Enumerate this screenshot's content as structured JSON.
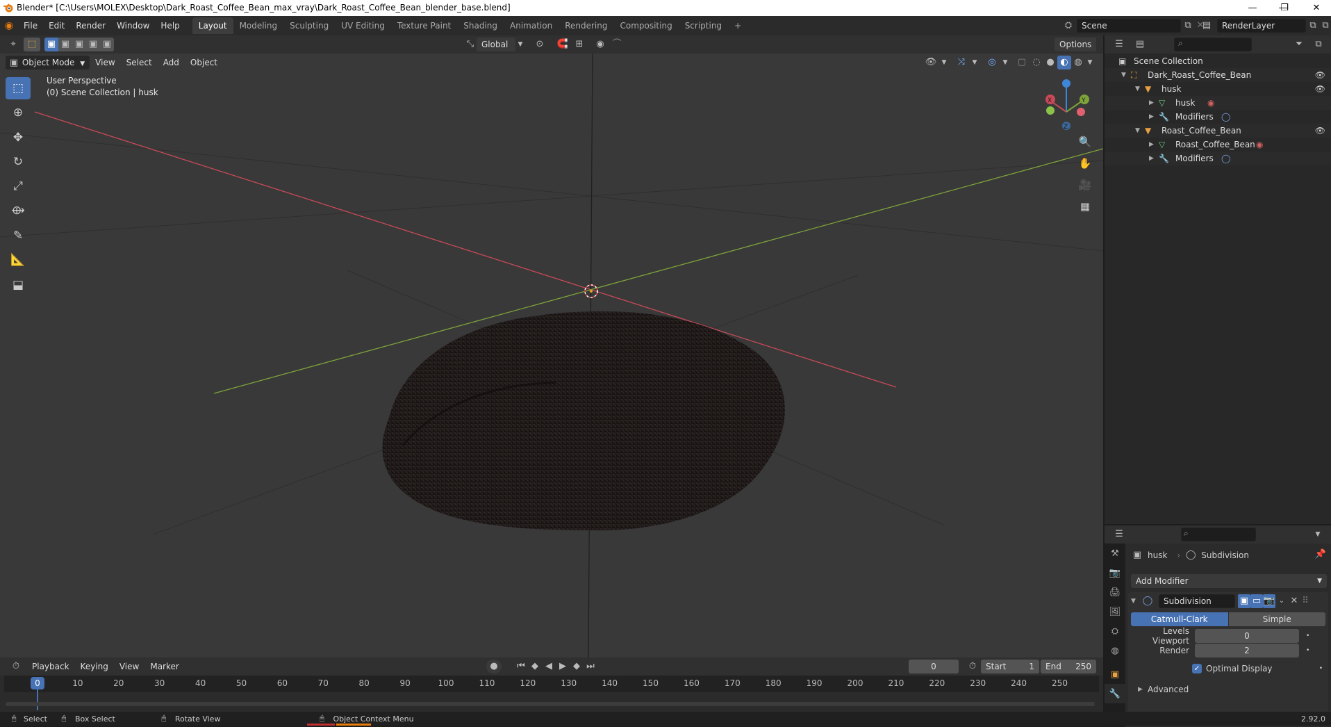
{
  "window": {
    "title": "Blender* [C:\\Users\\MOLEX\\Desktop\\Dark_Roast_Coffee_Bean_max_vray\\Dark_Roast_Coffee_Bean_blender_base.blend]",
    "controls": [
      "—",
      "❐",
      "✕"
    ]
  },
  "menu": [
    "File",
    "Edit",
    "Render",
    "Window",
    "Help"
  ],
  "workspaces": [
    "Layout",
    "Modeling",
    "Sculpting",
    "UV Editing",
    "Texture Paint",
    "Shading",
    "Animation",
    "Rendering",
    "Compositing",
    "Scripting"
  ],
  "workspace_add": "+",
  "scene": {
    "name": "Scene",
    "render_layer": "RenderLayer"
  },
  "viewport": {
    "transform_orientation": "Global",
    "options_label": "Options",
    "mode": "Object Mode",
    "header_menus": [
      "View",
      "Select",
      "Add",
      "Object"
    ],
    "overlay_title": "User Perspective",
    "overlay_sub": "(0) Scene Collection | husk",
    "gizmo_axes": [
      "X",
      "Y",
      "Z"
    ]
  },
  "outliner": {
    "search_placeholder": "",
    "rows": [
      {
        "label": "Scene Collection",
        "icon": "collection-icon",
        "visible": false
      },
      {
        "label": "Dark_Roast_Coffee_Bean",
        "icon": "scene-object-icon",
        "visible": true
      },
      {
        "label": "husk",
        "icon": "object-icon",
        "visible": true
      },
      {
        "label": "husk",
        "icon": "mesh-icon",
        "visible": false
      },
      {
        "label": "Modifiers",
        "icon": "wrench-icon",
        "visible": false
      },
      {
        "label": "Roast_Coffee_Bean",
        "icon": "object-icon",
        "visible": true
      },
      {
        "label": "Roast_Coffee_Bean",
        "icon": "mesh-icon",
        "visible": false
      },
      {
        "label": "Modifiers",
        "icon": "wrench-icon",
        "visible": false
      }
    ]
  },
  "properties": {
    "breadcrumb_object": "husk",
    "breadcrumb_modifier": "Subdivision",
    "add_modifier": "Add Modifier",
    "modifier_name": "Subdivision",
    "mode_catmull": "Catmull-Clark",
    "mode_simple": "Simple",
    "levels_viewport_label": "Levels Viewport",
    "levels_viewport_value": "0",
    "render_label": "Render",
    "render_value": "2",
    "optimal_display": "Optimal Display",
    "advanced": "Advanced"
  },
  "timeline": {
    "menus": [
      "Playback",
      "Keying",
      "View",
      "Marker"
    ],
    "current_frame": "0",
    "start_label": "Start",
    "start_value": "1",
    "end_label": "End",
    "end_value": "250",
    "ruler_marks": [
      "10",
      "20",
      "30",
      "40",
      "50",
      "60",
      "70",
      "80",
      "90",
      "100",
      "110",
      "120",
      "130",
      "140",
      "150",
      "160",
      "170",
      "180",
      "190",
      "200",
      "210",
      "220",
      "230",
      "240",
      "250"
    ],
    "playhead": "0"
  },
  "status": {
    "select": "Select",
    "box_select": "Box Select",
    "rotate_view": "Rotate View",
    "context_menu": "Object Context Menu",
    "version": "2.92.0"
  },
  "colors": {
    "accent": "#4772b3",
    "x_axis": "#c84a58",
    "y_axis": "#7ea33a",
    "z_axis": "#3f87d6"
  }
}
